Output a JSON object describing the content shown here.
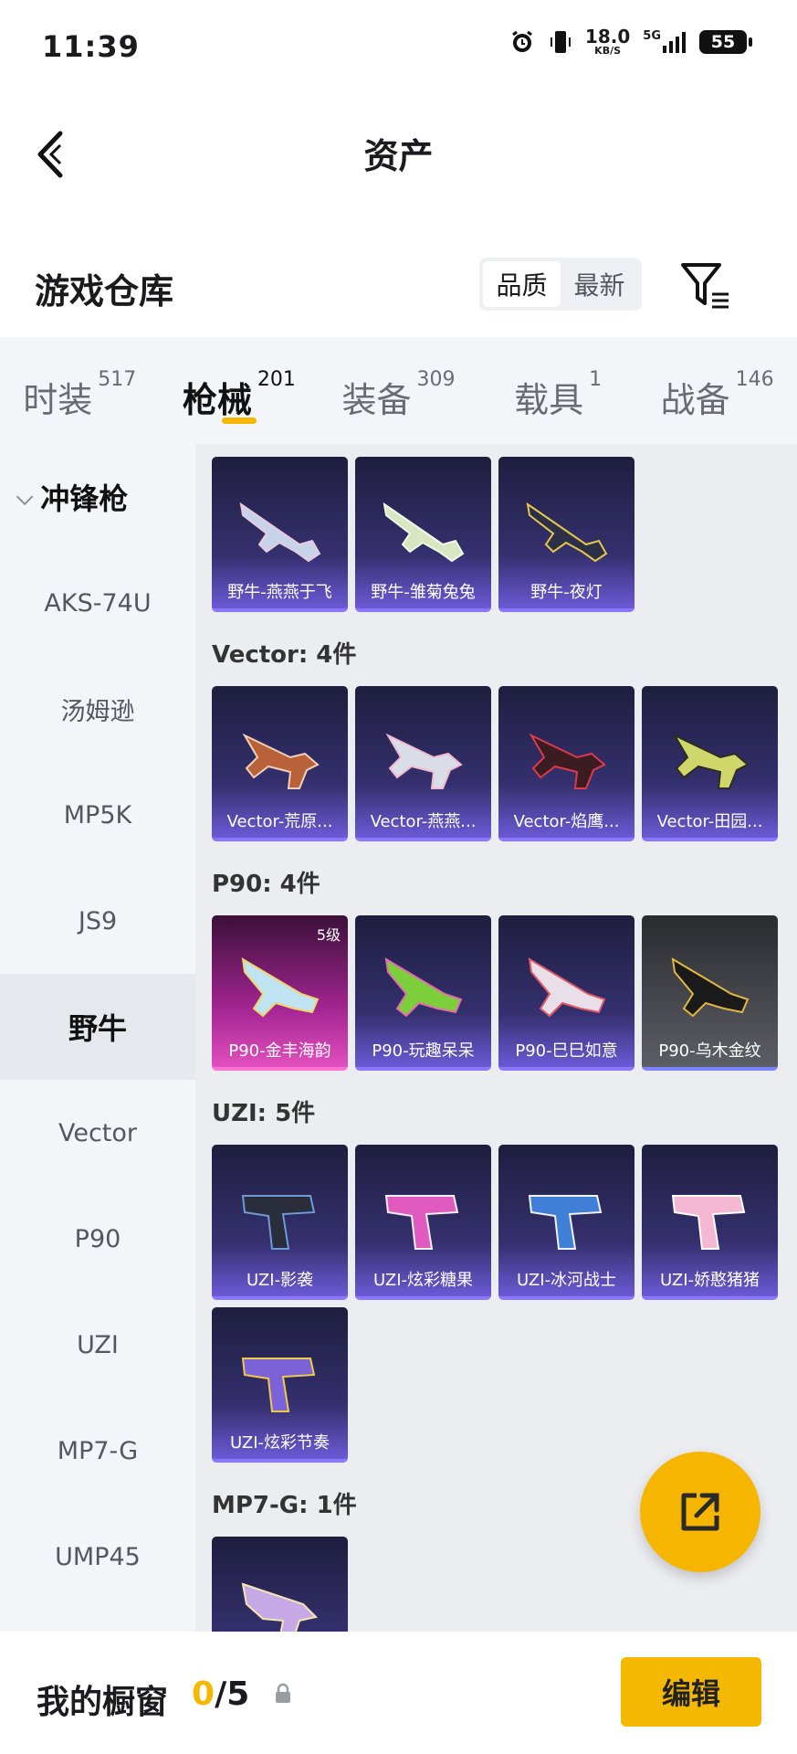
{
  "status_bar": {
    "time": "11:39",
    "net_speed": "18.0",
    "net_unit": "KB/S",
    "net_type": "5G",
    "battery": "55"
  },
  "header": {
    "title": "资产"
  },
  "warehouse": {
    "title": "游戏仓库",
    "sort_options": [
      "品质",
      "最新"
    ],
    "active_sort": "品质"
  },
  "tabs": [
    {
      "label": "时装",
      "count": "517"
    },
    {
      "label": "枪械",
      "count": "201",
      "active": true
    },
    {
      "label": "装备",
      "count": "309"
    },
    {
      "label": "载具",
      "count": "1"
    },
    {
      "label": "战备",
      "count": "146"
    }
  ],
  "sidebar": {
    "group": "冲锋枪",
    "items": [
      "AKS-74U",
      "汤姆逊",
      "MP5K",
      "JS9",
      "野牛",
      "Vector",
      "P90",
      "UZI",
      "MP7-G",
      "UMP45"
    ],
    "active": "野牛"
  },
  "content": {
    "bison_items": [
      "野牛-燕燕于飞",
      "野牛-雏菊兔兔",
      "野牛-夜灯"
    ],
    "sections": [
      {
        "title": "Vector: 4件",
        "items": [
          "Vector-荒原...",
          "Vector-燕燕...",
          "Vector-焰鹰...",
          "Vector-田园..."
        ]
      },
      {
        "title": "P90: 4件",
        "items": [
          "P90-金丰海韵",
          "P90-玩趣呆呆",
          "P90-巳巳如意",
          "P90-乌木金纹"
        ],
        "level": "5级"
      },
      {
        "title": "UZI: 5件",
        "items": [
          "UZI-影袭",
          "UZI-炫彩糖果",
          "UZI-冰河战士",
          "UZI-娇憨猪猪",
          "UZI-炫彩节奏"
        ]
      },
      {
        "title": "MP7-G: 1件",
        "items": [
          ""
        ]
      }
    ]
  },
  "bottom_bar": {
    "label": "我的橱窗",
    "count_current": "0",
    "count_total": "/5",
    "edit_label": "编辑"
  },
  "colors": {
    "accent": "#f5b800",
    "card_purple": "#35306f",
    "card_pink": "#a0248f"
  }
}
